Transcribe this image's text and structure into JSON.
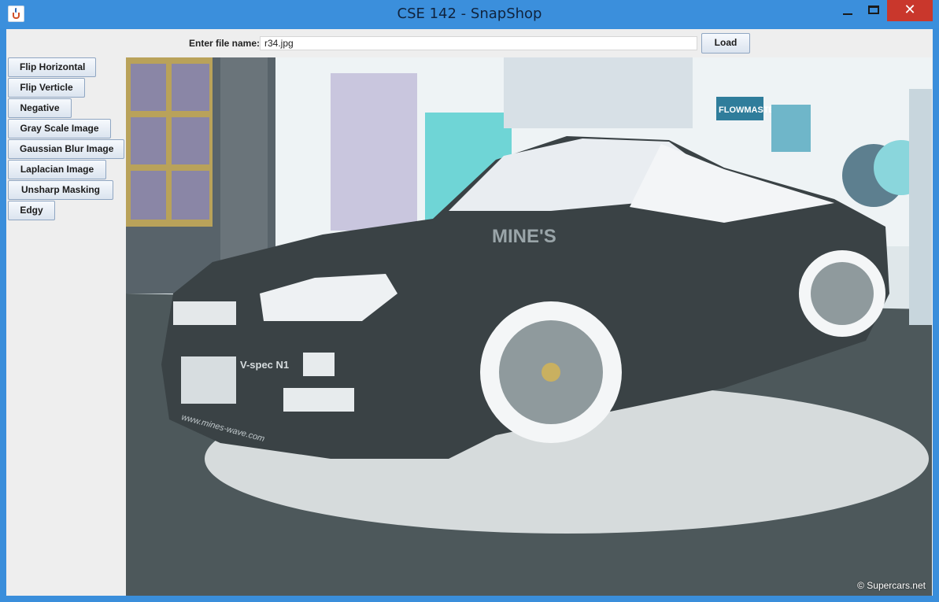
{
  "window": {
    "title": "CSE 142 - SnapShop",
    "close_glyph": "✕"
  },
  "toolbar": {
    "file_label": "Enter file name:",
    "file_value": "r34.jpg",
    "load_label": "Load"
  },
  "sidebar": {
    "buttons": [
      {
        "label": "Flip Horizontal"
      },
      {
        "label": "Flip Verticle"
      },
      {
        "label": "Negative"
      },
      {
        "label": "Gray Scale Image"
      },
      {
        "label": "Gaussian Blur Image"
      },
      {
        "label": "Laplacian Image"
      },
      {
        "label": "Unsharp Masking"
      },
      {
        "label": "Edgy"
      }
    ]
  },
  "image": {
    "car_text_brand": "MINE'S",
    "car_text_model": "V-spec N1",
    "car_text_url": "www.mines-wave.com",
    "banner_flowmaster": "FLOWMASTER",
    "watermark": "© Supercars.net"
  },
  "colors": {
    "titlebar": "#3b8fdc",
    "close": "#c9372c",
    "client_bg": "#eeeeee"
  }
}
